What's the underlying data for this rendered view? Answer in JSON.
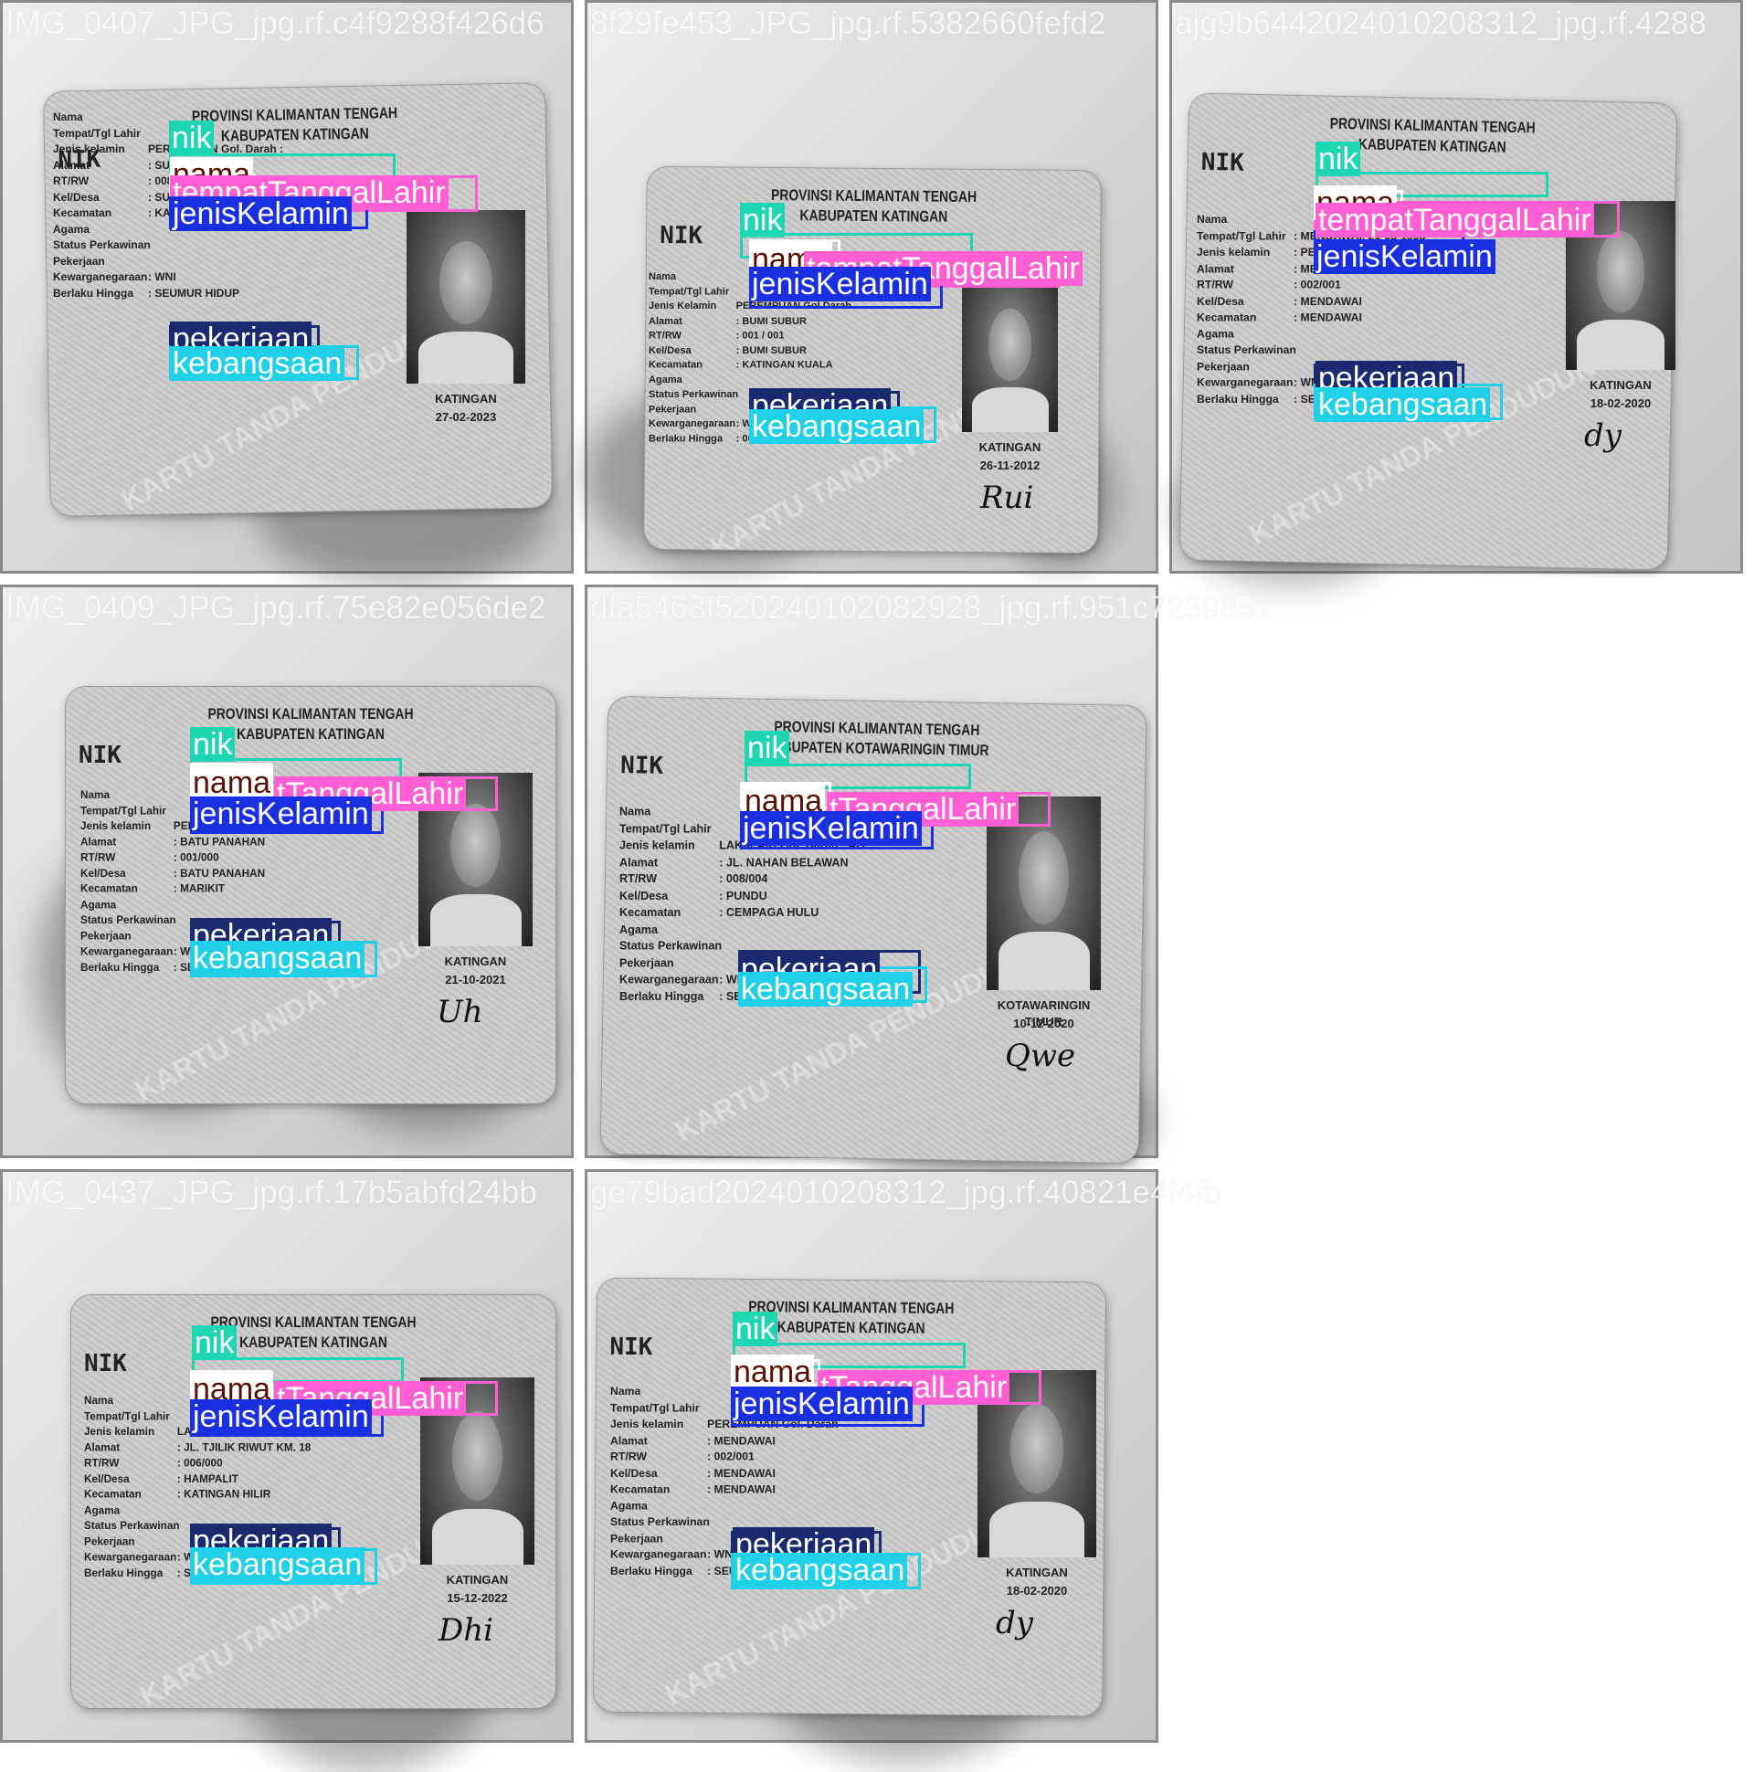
{
  "tiles": [
    {
      "name": "IMG_0407_JPG_jpg.rf.c4f9288f426d6",
      "card": {
        "provinsi": "PROVINSI KALIMANTAN TENGAH",
        "kabupaten": "KABUPATEN KATINGAN",
        "nik_label": "NIK",
        "rows": [
          {
            "label": "Nama",
            "value": ""
          },
          {
            "label": "Tempat/Tgl Lahir",
            "value": ""
          },
          {
            "label": "Jenis kelamin",
            "value": "PEREMPUAN      Gol. Darah :"
          },
          {
            "label": "Alamat",
            "value": ": SUBUR INDAH"
          },
          {
            "label": "RT/RW",
            "value": ": 008/002"
          },
          {
            "label": "Kel/Desa",
            "value": ": SUBUR INDAH"
          },
          {
            "label": "Kecamatan",
            "value": ": KATINGAN KUALA"
          },
          {
            "label": "Agama",
            "value": ""
          },
          {
            "label": "Status Perkawinan",
            "value": ""
          },
          {
            "label": "Pekerjaan",
            "value": ""
          },
          {
            "label": "Kewarganegaraan",
            "value": ": WNI"
          },
          {
            "label": "Berlaku Hingga",
            "value": ": SEUMUR HIDUP"
          }
        ],
        "issue_place": "KATINGAN",
        "issue_date": "27-02-2023",
        "watermark": "KARTU TANDA PENDUDUK",
        "signature": ""
      },
      "labels": {
        "nik": "nik",
        "nama": "nama",
        "ttl": "tempatTanggalLahir",
        "jk": "jenisKelamin",
        "pk": "pekerjaan",
        "kb": "kebangsaan"
      }
    },
    {
      "name": "8f29fe453_JPG_jpg.rf.5382660fefd2",
      "card": {
        "provinsi": "PROVINSI KALIMANTAN TENGAH",
        "kabupaten": "KABUPATEN KATINGAN",
        "nik_label": "NIK",
        "rows": [
          {
            "label": "Nama",
            "value": ""
          },
          {
            "label": "Tempat/Tgl Lahir",
            "value": ""
          },
          {
            "label": "Jenis Kelamin",
            "value": "PEREMPUAN      Gol Darah"
          },
          {
            "label": "Alamat",
            "value": ": BUMI SUBUR"
          },
          {
            "label": "RT/RW",
            "value": ": 001 / 001"
          },
          {
            "label": "Kel/Desa",
            "value": ": BUMI SUBUR"
          },
          {
            "label": "Kecamatan",
            "value": ": KATINGAN KUALA"
          },
          {
            "label": "Agama",
            "value": ""
          },
          {
            "label": "Status Perkawinan",
            "value": ""
          },
          {
            "label": "Pekerjaan",
            "value": ""
          },
          {
            "label": "Kewarganegaraan",
            "value": ": WNI"
          },
          {
            "label": "Berlaku Hingga",
            "value": ": 06-03-2017"
          }
        ],
        "issue_place": "KATINGAN",
        "issue_date": "26-11-2012",
        "watermark": "KARTU TANDA PENDUDUK",
        "signature": "Rui"
      },
      "labels": {
        "nik": "nik",
        "nama": "nama",
        "ttl": "tempatTanggalLahir",
        "jk": "jenisKelamin",
        "pk": "pekerjaan",
        "kb": "kebangsaan"
      }
    },
    {
      "name": "ajg9b6442024010208312_jpg.rf.4288",
      "card": {
        "provinsi": "PROVINSI KALIMANTAN TENGAH",
        "kabupaten": "KABUPATEN KATINGAN",
        "nik_label": "NIK",
        "rows": [
          {
            "label": "Nama",
            "value": ""
          },
          {
            "label": "Tempat/Tgl Lahir",
            "value": ": MENDAWAI, 21-05-1998"
          },
          {
            "label": "Jenis kelamin",
            "value": ": PEREMPUAN      Gol. Darah"
          },
          {
            "label": "Alamat",
            "value": ": MENDAWAI"
          },
          {
            "label": "RT/RW",
            "value": ": 002/001"
          },
          {
            "label": "Kel/Desa",
            "value": ": MENDAWAI"
          },
          {
            "label": "Kecamatan",
            "value": ": MENDAWAI"
          },
          {
            "label": "Agama",
            "value": ""
          },
          {
            "label": "Status Perkawinan",
            "value": ""
          },
          {
            "label": "Pekerjaan",
            "value": ""
          },
          {
            "label": "Kewarganegaraan",
            "value": ": WNI"
          },
          {
            "label": "Berlaku Hingga",
            "value": ": SEUMUR HIDUP"
          }
        ],
        "issue_place": "KATINGAN",
        "issue_date": "18-02-2020",
        "watermark": "KARTU TANDA PENDUDUK",
        "signature": "dy"
      },
      "labels": {
        "nik": "nik",
        "nama": "nama",
        "ttl": "tempatTanggalLahir",
        "jk": "jenisKelamin",
        "pk": "pekerjaan",
        "kb": "kebangsaan"
      }
    },
    {
      "name": "IMG_0409_JPG_jpg.rf.75e82e056de2",
      "card": {
        "provinsi": "PROVINSI KALIMANTAN TENGAH",
        "kabupaten": "KABUPATEN KATINGAN",
        "nik_label": "NIK",
        "rows": [
          {
            "label": "Nama",
            "value": ""
          },
          {
            "label": "Tempat/Tgl Lahir",
            "value": ""
          },
          {
            "label": "Jenis kelamin",
            "value": "PEREMPUAN      Gol. Darah"
          },
          {
            "label": "Alamat",
            "value": ": BATU PANAHAN"
          },
          {
            "label": "RT/RW",
            "value": ": 001/000"
          },
          {
            "label": "Kel/Desa",
            "value": ": BATU PANAHAN"
          },
          {
            "label": "Kecamatan",
            "value": ": MARIKIT"
          },
          {
            "label": "Agama",
            "value": ""
          },
          {
            "label": "Status Perkawinan",
            "value": ""
          },
          {
            "label": "Pekerjaan",
            "value": ""
          },
          {
            "label": "Kewarganegaraan",
            "value": ": WNI"
          },
          {
            "label": "Berlaku Hingga",
            "value": ": SEUMUR HIDUP"
          }
        ],
        "issue_place": "KATINGAN",
        "issue_date": "21-10-2021",
        "watermark": "KARTU TANDA PENDUDUK",
        "signature": "Uh"
      },
      "labels": {
        "nik": "nik",
        "nama": "nama",
        "ttl": "tTanggalLahir",
        "jk": "jenisKelamin",
        "pk": "pekerjaan",
        "kb": "kebangsaan"
      }
    },
    {
      "name": "dfa5463f520240102082928_jpg.rf.951c7239851",
      "card": {
        "provinsi": "PROVINSI KALIMANTAN TENGAH",
        "kabupaten": "KABUPATEN KOTAWARINGIN TIMUR",
        "nik_label": "NIK",
        "rows": [
          {
            "label": "Nama",
            "value": ""
          },
          {
            "label": "Tempat/Tgl Lahir",
            "value": ""
          },
          {
            "label": "Jenis kelamin",
            "value": "LAKI-LAKI      Gol. Darah : AB"
          },
          {
            "label": "Alamat",
            "value": ": JL. NAHAN BELAWAN"
          },
          {
            "label": "RT/RW",
            "value": ": 008/004"
          },
          {
            "label": "Kel/Desa",
            "value": ": PUNDU"
          },
          {
            "label": "Kecamatan",
            "value": ": CEMPAGA HULU"
          },
          {
            "label": "Agama",
            "value": ""
          },
          {
            "label": "Status Perkawinan",
            "value": ""
          },
          {
            "label": "Pekerjaan",
            "value": ""
          },
          {
            "label": "Kewarganegaraan",
            "value": ": WNI"
          },
          {
            "label": "Berlaku Hingga",
            "value": ": SEUMUR HIDUP"
          }
        ],
        "issue_place": "KOTAWARINGIN TIMUR",
        "issue_date": "10-12-2020",
        "watermark": "KARTU TANDA PENDUDUK",
        "signature": "Qwe"
      },
      "labels": {
        "nik": "nik",
        "nama": "nama",
        "ttl": "tTanggalLahir",
        "jk": "jenisKelamin",
        "pk": "pekerjaan",
        "kb": "kebangsaan"
      }
    },
    {
      "name": "IMG_0437_JPG_jpg.rf.17b5abfd24bb",
      "card": {
        "provinsi": "PROVINSI KALIMANTAN TENGAH",
        "kabupaten": "KABUPATEN KATINGAN",
        "nik_label": "NIK",
        "rows": [
          {
            "label": "Nama",
            "value": ""
          },
          {
            "label": "Tempat/Tgl Lahir",
            "value": ""
          },
          {
            "label": "Jenis kelamin",
            "value": "LAKI-LAKI      Gol. Darah"
          },
          {
            "label": "Alamat",
            "value": ": JL. TJILIK RIWUT KM. 18"
          },
          {
            "label": "RT/RW",
            "value": ": 006/000"
          },
          {
            "label": "Kel/Desa",
            "value": ": HAMPALIT"
          },
          {
            "label": "Kecamatan",
            "value": ": KATINGAN HILIR"
          },
          {
            "label": "Agama",
            "value": ""
          },
          {
            "label": "Status Perkawinan",
            "value": ""
          },
          {
            "label": "Pekerjaan",
            "value": ""
          },
          {
            "label": "Kewarganegaraan",
            "value": ": WNI"
          },
          {
            "label": "Berlaku Hingga",
            "value": ": SEUMUR HIDUP"
          }
        ],
        "issue_place": "KATINGAN",
        "issue_date": "15-12-2022",
        "watermark": "KARTU TANDA PENDUDUK",
        "signature": "Dhi"
      },
      "labels": {
        "nik": "nik",
        "nama": "nama",
        "ttl": "tTanggalLahir",
        "jk": "jenisKelamin",
        "pk": "pekerjaan",
        "kb": "kebangsaan"
      }
    },
    {
      "name": "ge79bad2024010208312_jpg.rf.40821e4f4fb",
      "card": {
        "provinsi": "PROVINSI KALIMANTAN TENGAH",
        "kabupaten": "KABUPATEN KATINGAN",
        "nik_label": "NIK",
        "rows": [
          {
            "label": "Nama",
            "value": ""
          },
          {
            "label": "Tempat/Tgl Lahir",
            "value": ""
          },
          {
            "label": "Jenis kelamin",
            "value": "PEREMPUAN      Gol. Darah"
          },
          {
            "label": "Alamat",
            "value": ": MENDAWAI"
          },
          {
            "label": "RT/RW",
            "value": ": 002/001"
          },
          {
            "label": "Kel/Desa",
            "value": ": MENDAWAI"
          },
          {
            "label": "Kecamatan",
            "value": ": MENDAWAI"
          },
          {
            "label": "Agama",
            "value": ""
          },
          {
            "label": "Status Perkawinan",
            "value": ""
          },
          {
            "label": "Pekerjaan",
            "value": ""
          },
          {
            "label": "Kewarganegaraan",
            "value": ": WNI"
          },
          {
            "label": "Berlaku Hingga",
            "value": ": SEUMUR HIDUP"
          }
        ],
        "issue_place": "KATINGAN",
        "issue_date": "18-02-2020",
        "watermark": "KARTU TANDA PENDUDUK",
        "signature": "dy"
      },
      "labels": {
        "nik": "nik",
        "nama": "nama",
        "ttl": "tTanggalLahir",
        "jk": "jenisKelamin",
        "pk": "pekerjaan",
        "kb": "kebangsaan"
      }
    }
  ]
}
